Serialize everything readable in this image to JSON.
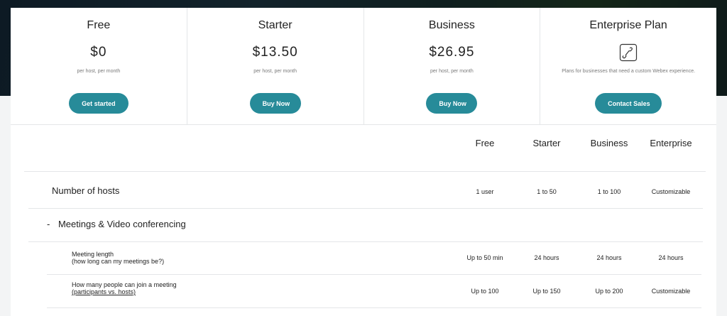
{
  "plans": [
    {
      "name": "Free",
      "price": "$0",
      "sub": "per host, per month",
      "button": "Get started"
    },
    {
      "name": "Starter",
      "price": "$13.50",
      "sub": "per host, per month",
      "button": "Buy Now"
    },
    {
      "name": "Business",
      "price": "$26.95",
      "sub": "per host, per month",
      "button": "Buy Now"
    },
    {
      "name": "Enterprise Plan",
      "icon": "phone-handset-icon",
      "sub": "Plans for businesses that need a custom Webex experience.",
      "button": "Contact Sales"
    }
  ],
  "columns": [
    "Free",
    "Starter",
    "Business",
    "Enterprise"
  ],
  "rows": {
    "hosts": {
      "label": "Number of hosts",
      "values": [
        "1 user",
        "1 to 50",
        "1 to 100",
        "Customizable"
      ]
    },
    "section": {
      "toggle": "-",
      "label": "Meetings & Video conferencing"
    },
    "meeting_length": {
      "label": "Meeting length",
      "note": "(how long can my meetings be?)",
      "values": [
        "Up to 50 min",
        "24 hours",
        "24 hours",
        "24 hours"
      ]
    },
    "participants": {
      "label": "How many people can join a meeting",
      "note": "(participants vs. hosts)",
      "values": [
        "Up to 100",
        "Up to 150",
        "Up to 200",
        "Customizable"
      ]
    }
  },
  "colors": {
    "accent": "#278b99",
    "header_bg": "#0f1f24"
  }
}
